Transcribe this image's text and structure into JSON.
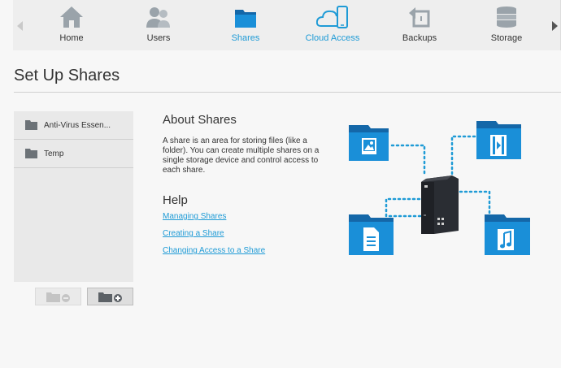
{
  "nav": {
    "items": [
      {
        "id": "home",
        "label": "Home",
        "icon": "home-icon"
      },
      {
        "id": "users",
        "label": "Users",
        "icon": "users-icon"
      },
      {
        "id": "shares",
        "label": "Shares",
        "icon": "folder-icon",
        "active": true
      },
      {
        "id": "cloud",
        "label": "Cloud Access",
        "icon": "cloud-access-icon"
      },
      {
        "id": "backups",
        "label": "Backups",
        "icon": "backups-icon"
      },
      {
        "id": "storage",
        "label": "Storage",
        "icon": "storage-icon"
      }
    ]
  },
  "page": {
    "title": "Set Up Shares"
  },
  "shares": {
    "items": [
      {
        "name": "Anti-Virus Essen..."
      },
      {
        "name": "Temp"
      }
    ]
  },
  "about": {
    "heading": "About Shares",
    "text": "A share is an area for storing files (like a folder). You can create multiple shares on a single storage device and control access to each share."
  },
  "help": {
    "heading": "Help",
    "links": [
      "Managing Shares",
      "Creating a Share",
      "Changing Access to a Share"
    ]
  },
  "colors": {
    "accent": "#1f9bd6",
    "folder_blue": "#1a8fd8",
    "folder_dark": "#1467a8",
    "nas": "#2a2d33"
  }
}
